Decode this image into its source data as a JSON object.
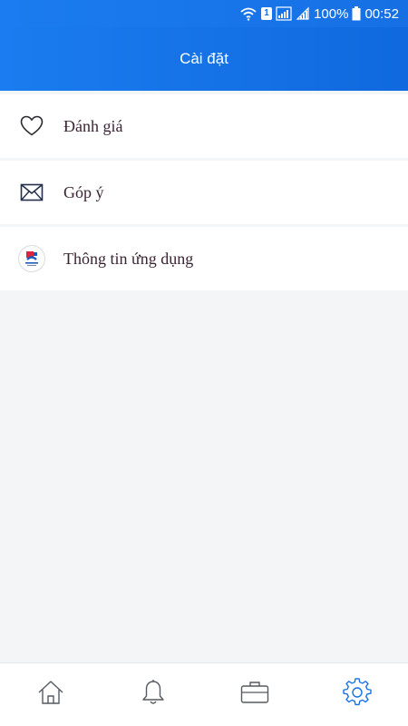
{
  "status_bar": {
    "sim_label": "1",
    "battery_percent": "100%",
    "time": "00:52"
  },
  "header": {
    "title": "Cài đặt"
  },
  "settings": {
    "items": [
      {
        "label": "Đánh giá",
        "icon": "heart-icon"
      },
      {
        "label": "Góp ý",
        "icon": "mail-icon"
      },
      {
        "label": "Thông tin ứng dụng",
        "icon": "app-logo"
      }
    ]
  },
  "bottom_nav": {
    "tabs": [
      {
        "icon": "home-icon",
        "active": false
      },
      {
        "icon": "bell-icon",
        "active": false
      },
      {
        "icon": "briefcase-icon",
        "active": false
      },
      {
        "icon": "gear-icon",
        "active": true
      }
    ],
    "active_color": "#1670e4",
    "inactive_color": "#555a60"
  },
  "colors": {
    "header_blue": "#1670e4",
    "label_text": "#3a2434",
    "background": "#f4f5f7"
  }
}
